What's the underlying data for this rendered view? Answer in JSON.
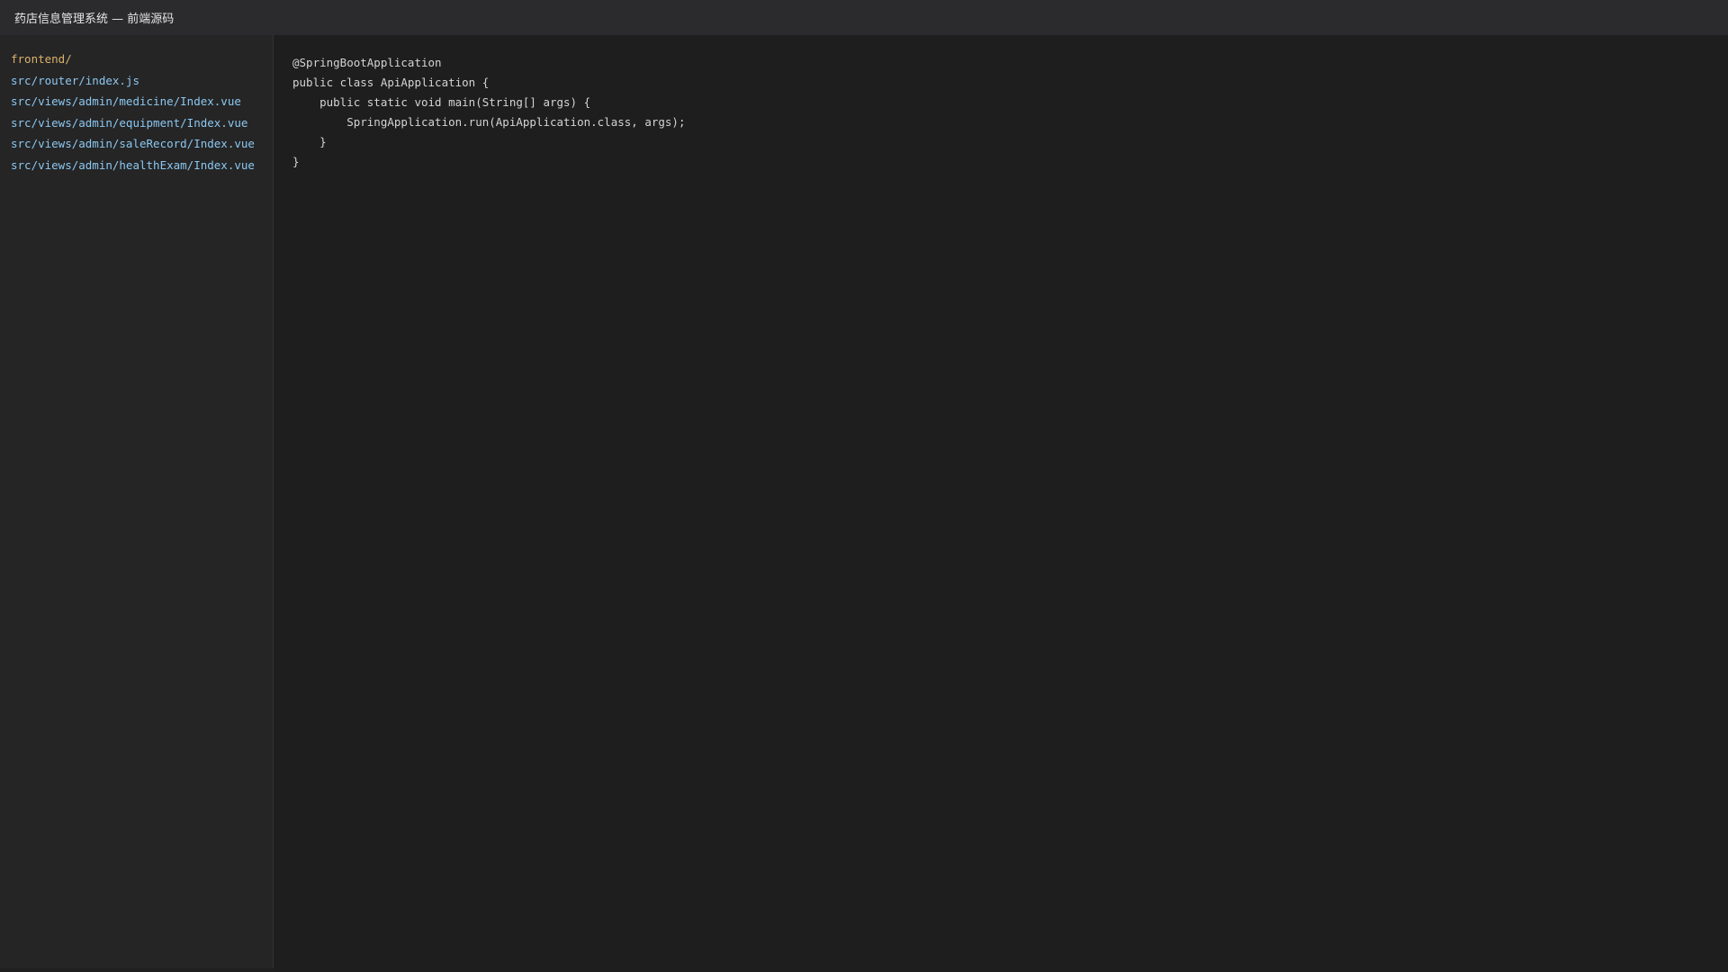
{
  "window": {
    "title": "药店信息管理系统 — 前端源码"
  },
  "sidebar": {
    "items": [
      {
        "label": "frontend/",
        "kind": "folder"
      },
      {
        "label": "src/router/index.js",
        "kind": "file"
      },
      {
        "label": "src/views/admin/medicine/Index.vue",
        "kind": "file"
      },
      {
        "label": "src/views/admin/equipment/Index.vue",
        "kind": "file"
      },
      {
        "label": "src/views/admin/saleRecord/Index.vue",
        "kind": "file"
      },
      {
        "label": "src/views/admin/healthExam/Index.vue",
        "kind": "file"
      }
    ]
  },
  "editor": {
    "lines": [
      "@SpringBootApplication",
      "public class ApiApplication {",
      "    public static void main(String[] args) {",
      "        SpringApplication.run(ApiApplication.class, args);",
      "    }",
      "}"
    ]
  },
  "colors": {
    "titlebar_bg": "#2b2b2d",
    "sidebar_bg": "#252526",
    "editor_bg": "#1e1e1e",
    "folder_text": "#dcb36a",
    "file_text": "#8cc8f0",
    "code_text": "#d4d4d4"
  }
}
